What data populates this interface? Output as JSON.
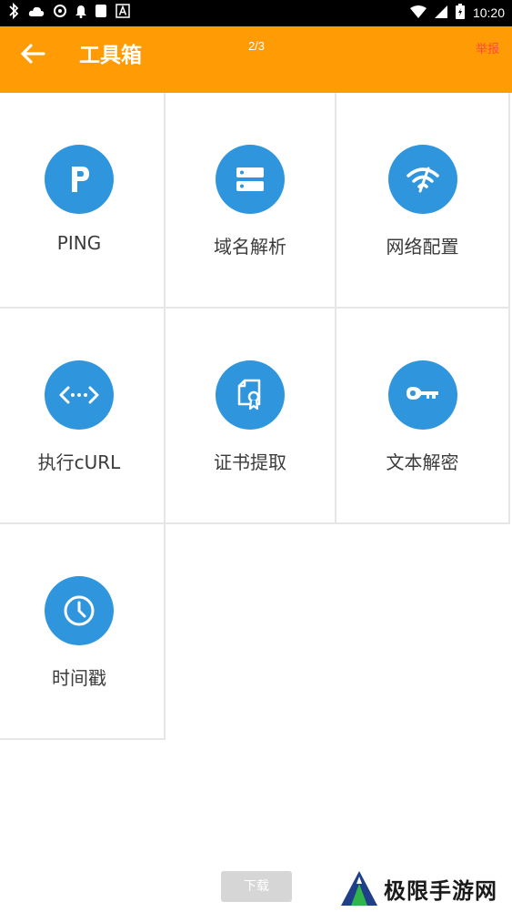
{
  "status_bar": {
    "time": "10:20",
    "left_icons": [
      "bluetooth-icon",
      "cloud-icon",
      "target-icon",
      "notification-bell-icon",
      "white-square-icon",
      "a-badge-icon"
    ],
    "right_icons": [
      "wifi-icon",
      "signal-icon",
      "battery-icon"
    ]
  },
  "app_bar": {
    "title": "工具箱",
    "page_indicator": "2/3",
    "report_label": "举报",
    "color": "#ff9b05"
  },
  "tools": [
    {
      "label": "PING",
      "icon": "ping-p-icon"
    },
    {
      "label": "域名解析",
      "icon": "dns-server-icon"
    },
    {
      "label": "网络配置",
      "icon": "wifi-config-icon"
    },
    {
      "label": "执行cURL",
      "icon": "code-brackets-icon"
    },
    {
      "label": "证书提取",
      "icon": "certificate-icon"
    },
    {
      "label": "文本解密",
      "icon": "key-icon"
    },
    {
      "label": "时间戳",
      "icon": "clock-icon"
    }
  ],
  "icon_color": "#2f96de",
  "download_label": "下载",
  "watermark": {
    "text": "极限手游网"
  }
}
